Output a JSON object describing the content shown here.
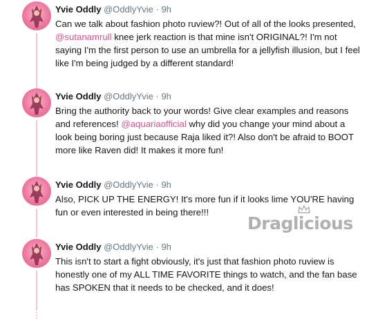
{
  "tweets": [
    {
      "name": "Yvie Oddly",
      "handle": "@OddlyYvie",
      "sep": "·",
      "time": "9h",
      "text_parts": [
        {
          "t": "Can we talk about fashion photo ruview?! Out of all of the looks presented, ",
          "mention": false
        },
        {
          "t": "@sutanamrull",
          "mention": true
        },
        {
          "t": " knee jerk reaction is that mine isn't ORIGINAL?! I'm not saying I'm the first person to use an umbrella for a jellyfish illusion, but I feel like I'm being judged by a different standard!",
          "mention": false
        }
      ]
    },
    {
      "name": "Yvie Oddly",
      "handle": "@OddlyYvie",
      "sep": "·",
      "time": "9h",
      "text_parts": [
        {
          "t": "Bring the authority back to your words! Give clear examples and reasons and references! ",
          "mention": false
        },
        {
          "t": "@aquariaofficial",
          "mention": true
        },
        {
          "t": " why did you change your mind about a look being boring just because Raja liked it?! Also don't be afraid to BOOT more like Raven did! It makes it more fun!",
          "mention": false
        }
      ]
    },
    {
      "name": "Yvie Oddly",
      "handle": "@OddlyYvie",
      "sep": "·",
      "time": "9h",
      "text_parts": [
        {
          "t": "Also, PICK UP THE ENERGY! It's more fun if it looks lime YOU'RE having fun or even interested in being there!!!",
          "mention": false
        }
      ]
    },
    {
      "name": "Yvie Oddly",
      "handle": "@OddlyYvie",
      "sep": "·",
      "time": "9h",
      "text_parts": [
        {
          "t": "This isn't to start a fight obviously, it's just that fashion photo ruview is honestly one of my ALL TIME FAVORITE things to watch, and the fan base has SPOKEN that it needs to be checked, and it does!",
          "mention": false
        }
      ]
    }
  ],
  "watermark": {
    "text": "Draglicious"
  },
  "colors": {
    "mention": "#e0508a",
    "thread_line": "#f4c8d6",
    "meta": "#657786"
  },
  "icons": {
    "avatar": "user-avatar",
    "crown": "crown-icon"
  }
}
